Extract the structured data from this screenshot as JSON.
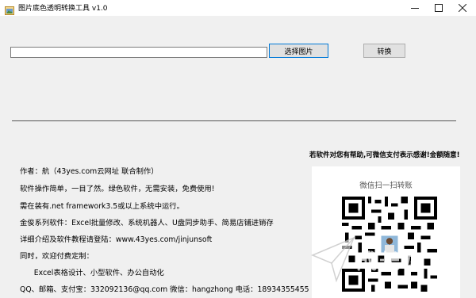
{
  "window": {
    "title": "图片底色透明转换工具 v1.0",
    "controls": {
      "minimize": "—",
      "maximize": "☐",
      "close": "✕"
    }
  },
  "toolbar": {
    "path_input_value": "",
    "select_label": "选择图片",
    "convert_label": "转换"
  },
  "promo": {
    "text": "若软件对您有帮助,可微信支付表示感谢!金额随意!"
  },
  "info_lines": [
    "作者：航（43yes.com云网址 联合制作）",
    "软件操作简单，一目了然。绿色软件，无需安装，免费使用!",
    "需在装有.net framework3.5或以上系统中运行。",
    "金俊系列软件：Excel批量修改、系统机器人、U盘同步助手、简易店铺进销存",
    "详细介绍及软件教程请登陆：www.43yes.com/jinjunsoft",
    "同时，欢迎付费定制：",
    "      Excel表格设计、小型软件、办公自动化",
    "QQ、邮箱、支付宝：332092136@qq.com  微信：hangzhong 电话：18934355455"
  ],
  "qr": {
    "title": "微信扫一扫转账"
  },
  "watermark": {
    "text": "成长站"
  },
  "colors": {
    "window_bg": "#f0f0f0",
    "accent_border": "#0078d7"
  }
}
